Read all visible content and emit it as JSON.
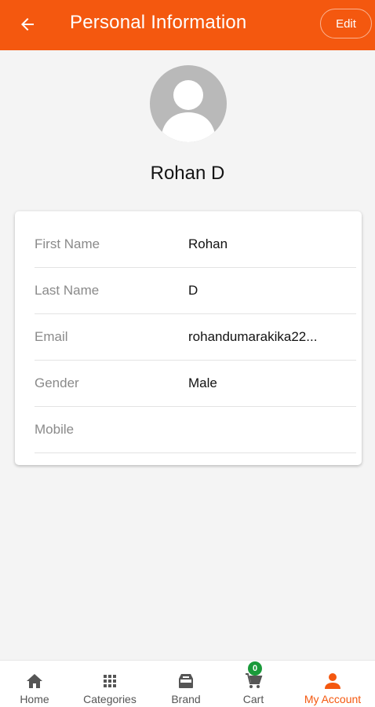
{
  "header": {
    "title": "Personal Information",
    "edit_label": "Edit"
  },
  "profile": {
    "name": "Rohan D"
  },
  "details": [
    {
      "label": "First Name",
      "value": "Rohan"
    },
    {
      "label": "Last Name",
      "value": "D"
    },
    {
      "label": "Email",
      "value": "rohandumarakika22..."
    },
    {
      "label": "Gender",
      "value": "Male"
    },
    {
      "label": "Mobile",
      "value": ""
    }
  ],
  "nav": {
    "items": [
      {
        "label": "Home",
        "icon": "home-icon"
      },
      {
        "label": "Categories",
        "icon": "grid-icon"
      },
      {
        "label": "Brand",
        "icon": "inbox-icon"
      },
      {
        "label": "Cart",
        "icon": "cart-icon"
      },
      {
        "label": "My Account",
        "icon": "person-icon"
      }
    ],
    "cart_count": "0"
  },
  "colors": {
    "primary": "#f4580f",
    "badge": "#1a9a3a"
  }
}
